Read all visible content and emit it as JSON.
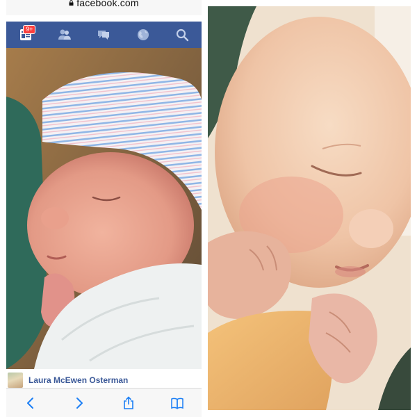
{
  "browser": {
    "url_domain": "facebook.com"
  },
  "nav": {
    "notification_count": "9+",
    "items": [
      "newsfeed-icon",
      "friends-icon",
      "messages-icon",
      "globe-icon",
      "search-icon"
    ],
    "bar_color": "#3b5998"
  },
  "post": {
    "author_name": "Laura McEwen Osterman",
    "link_color": "#3b5998"
  },
  "toolbar": {
    "items": [
      "back-icon",
      "forward-icon",
      "share-icon",
      "bookmarks-icon"
    ],
    "tint": "#1a7ef5"
  }
}
